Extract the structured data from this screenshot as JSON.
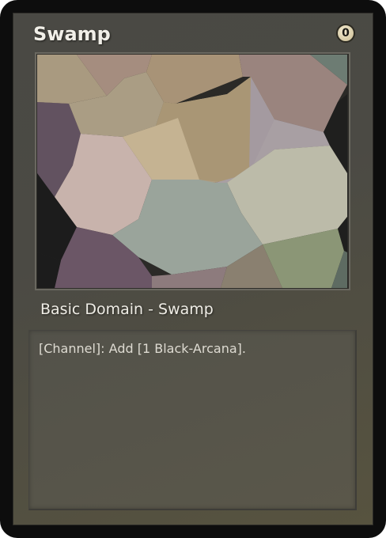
{
  "card": {
    "name": "Swamp",
    "cost": "0",
    "type_line": "Basic Domain - Swamp",
    "rules_text": "[Channel]: Add [1 Black-Arcana].",
    "art": {
      "description": "abstract voronoi mosaic in muted earth and mauve tones"
    }
  },
  "colors": {
    "card_border": "#0d0d0d",
    "card_face": "#4b4a44",
    "text_box": "#57554a",
    "title_text": "#f1efe8",
    "cost_badge": "#d6caa5"
  },
  "icons": {
    "cost_badge": "mana-cost-icon"
  }
}
